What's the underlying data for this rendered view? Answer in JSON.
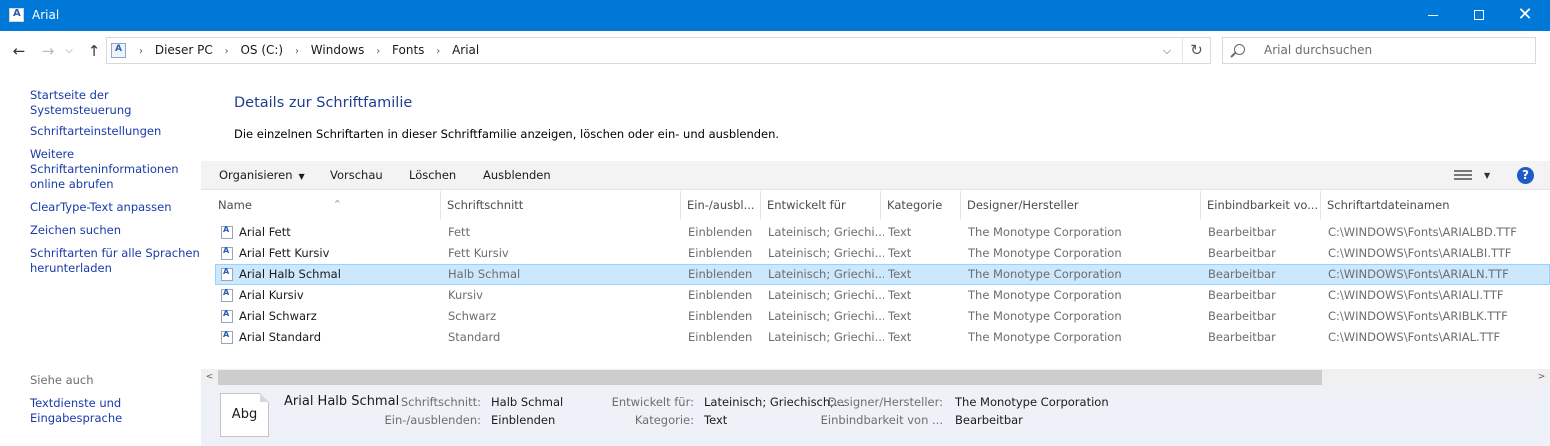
{
  "window": {
    "title": "Arial",
    "minimize_label": "—",
    "maximize_label": "",
    "close_label": "✕"
  },
  "nav": {
    "back_glyph": "←",
    "forward_glyph": "→",
    "recent_glyph": "⌵",
    "up_glyph": "↑",
    "breadcrumb": [
      "Dieser PC",
      "OS (C:)",
      "Windows",
      "Fonts",
      "Arial"
    ],
    "breadcrumb_sep": "›",
    "dropdown_glyph": "⌵",
    "refresh_glyph": "↻",
    "search_placeholder": "Arial durchsuchen"
  },
  "sidebar": {
    "links": [
      "Startseite der Systemsteuerung",
      "Schriftarteinstellungen",
      "Weitere Schriftarteninformationen online abrufen",
      "ClearType-Text anpassen",
      "Zeichen suchen",
      "Schriftarten für alle Sprachen herunterladen"
    ],
    "see_also_label": "Siehe auch",
    "see_also_links": [
      "Textdienste und Eingabesprache"
    ]
  },
  "main": {
    "heading": "Details zur Schriftfamilie",
    "description": "Die einzelnen Schriftarten in dieser Schriftfamilie anzeigen, löschen oder ein- und ausblenden."
  },
  "toolbar": {
    "organize": "Organisieren",
    "organize_caret": "▼",
    "preview": "Vorschau",
    "delete": "Löschen",
    "hide": "Ausblenden",
    "view_caret": "▼",
    "help": "?"
  },
  "columns": [
    "Name",
    "Schriftschnitt",
    "Ein-/ausbl...",
    "Entwickelt für",
    "Kategorie",
    "Designer/Hersteller",
    "Einbindbarkeit vo...",
    "Schriftartdateinamen"
  ],
  "sort_arrow": "^",
  "rows": [
    {
      "name": "Arial Fett",
      "style": "Fett",
      "visibility": "Einblenden",
      "designed_for": "Lateinisch; Griechi...",
      "category": "Text",
      "designer": "The Monotype Corporation",
      "embeddability": "Bearbeitbar",
      "filename": "C:\\WINDOWS\\Fonts\\ARIALBD.TTF",
      "selected": false
    },
    {
      "name": "Arial Fett Kursiv",
      "style": "Fett Kursiv",
      "visibility": "Einblenden",
      "designed_for": "Lateinisch; Griechi...",
      "category": "Text",
      "designer": "The Monotype Corporation",
      "embeddability": "Bearbeitbar",
      "filename": "C:\\WINDOWS\\Fonts\\ARIALBI.TTF",
      "selected": false
    },
    {
      "name": "Arial Halb Schmal",
      "style": "Halb Schmal",
      "visibility": "Einblenden",
      "designed_for": "Lateinisch; Griechi...",
      "category": "Text",
      "designer": "The Monotype Corporation",
      "embeddability": "Bearbeitbar",
      "filename": "C:\\WINDOWS\\Fonts\\ARIALN.TTF",
      "selected": true
    },
    {
      "name": "Arial Kursiv",
      "style": "Kursiv",
      "visibility": "Einblenden",
      "designed_for": "Lateinisch; Griechi...",
      "category": "Text",
      "designer": "The Monotype Corporation",
      "embeddability": "Bearbeitbar",
      "filename": "C:\\WINDOWS\\Fonts\\ARIALI.TTF",
      "selected": false
    },
    {
      "name": "Arial Schwarz",
      "style": "Schwarz",
      "visibility": "Einblenden",
      "designed_for": "Lateinisch; Griechi...",
      "category": "Text",
      "designer": "The Monotype Corporation",
      "embeddability": "Bearbeitbar",
      "filename": "C:\\WINDOWS\\Fonts\\ARIBLK.TTF",
      "selected": false
    },
    {
      "name": "Arial Standard",
      "style": "Standard",
      "visibility": "Einblenden",
      "designed_for": "Lateinisch; Griechi...",
      "category": "Text",
      "designer": "The Monotype Corporation",
      "embeddability": "Bearbeitbar",
      "filename": "C:\\WINDOWS\\Fonts\\ARIAL.TTF",
      "selected": false
    }
  ],
  "scrollbar": {
    "left_glyph": "<",
    "right_glyph": ">"
  },
  "details": {
    "thumbnail_text": "Abg",
    "title": "Arial Halb Schmal",
    "fields": {
      "style_label": "Schriftschnitt:",
      "style_value": "Halb Schmal",
      "visibility_label": "Ein-/ausblenden:",
      "visibility_value": "Einblenden",
      "designed_for_label": "Entwickelt für:",
      "designed_for_value": "Lateinisch; Griechisch;...",
      "category_label": "Kategorie:",
      "category_value": "Text",
      "designer_label": "Designer/Hersteller:",
      "designer_value": "The Monotype Corporation",
      "embeddability_label": "Einbindbarkeit von ...",
      "embeddability_value": "Bearbeitbar"
    }
  },
  "colors": {
    "titlebar": "#0078d7",
    "link": "#1a3ba8",
    "heading": "#1e3f8f",
    "selection": "#cce8ff",
    "selection_border": "#99d1ff",
    "details_bg": "#eef2f8"
  }
}
